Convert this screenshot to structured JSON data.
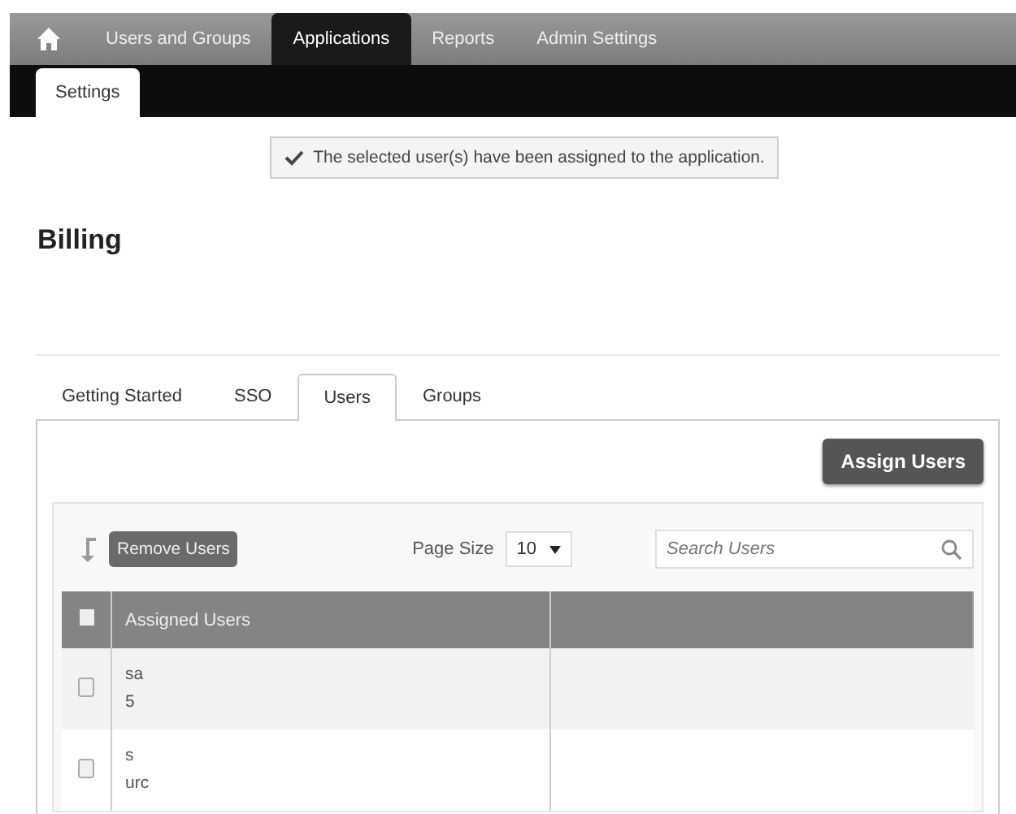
{
  "nav": {
    "tabs": [
      {
        "label": "Users and Groups",
        "selected": false
      },
      {
        "label": "Applications",
        "selected": true
      },
      {
        "label": "Reports",
        "selected": false
      },
      {
        "label": "Admin Settings",
        "selected": false
      }
    ],
    "subtabs": [
      {
        "label": "Settings",
        "selected": true
      }
    ]
  },
  "message": "The selected user(s) have been assigned to the application.",
  "title": "Billing",
  "tabs": [
    {
      "label": "Getting Started",
      "selected": false
    },
    {
      "label": "SSO",
      "selected": false
    },
    {
      "label": "Users",
      "selected": true
    },
    {
      "label": "Groups",
      "selected": false
    }
  ],
  "assign_button": "Assign Users",
  "toolbar": {
    "remove_button": "Remove Users",
    "page_size_label": "Page Size",
    "page_size": "10",
    "search": {
      "placeholder": "Search Users"
    }
  },
  "table": {
    "select_all_checked": false,
    "columns": [
      "Assigned Users"
    ],
    "rows": [
      {
        "checked": false,
        "lines": [
          "sa",
          "5"
        ]
      },
      {
        "checked": false,
        "lines": [
          "s",
          "urc"
        ]
      }
    ]
  }
}
